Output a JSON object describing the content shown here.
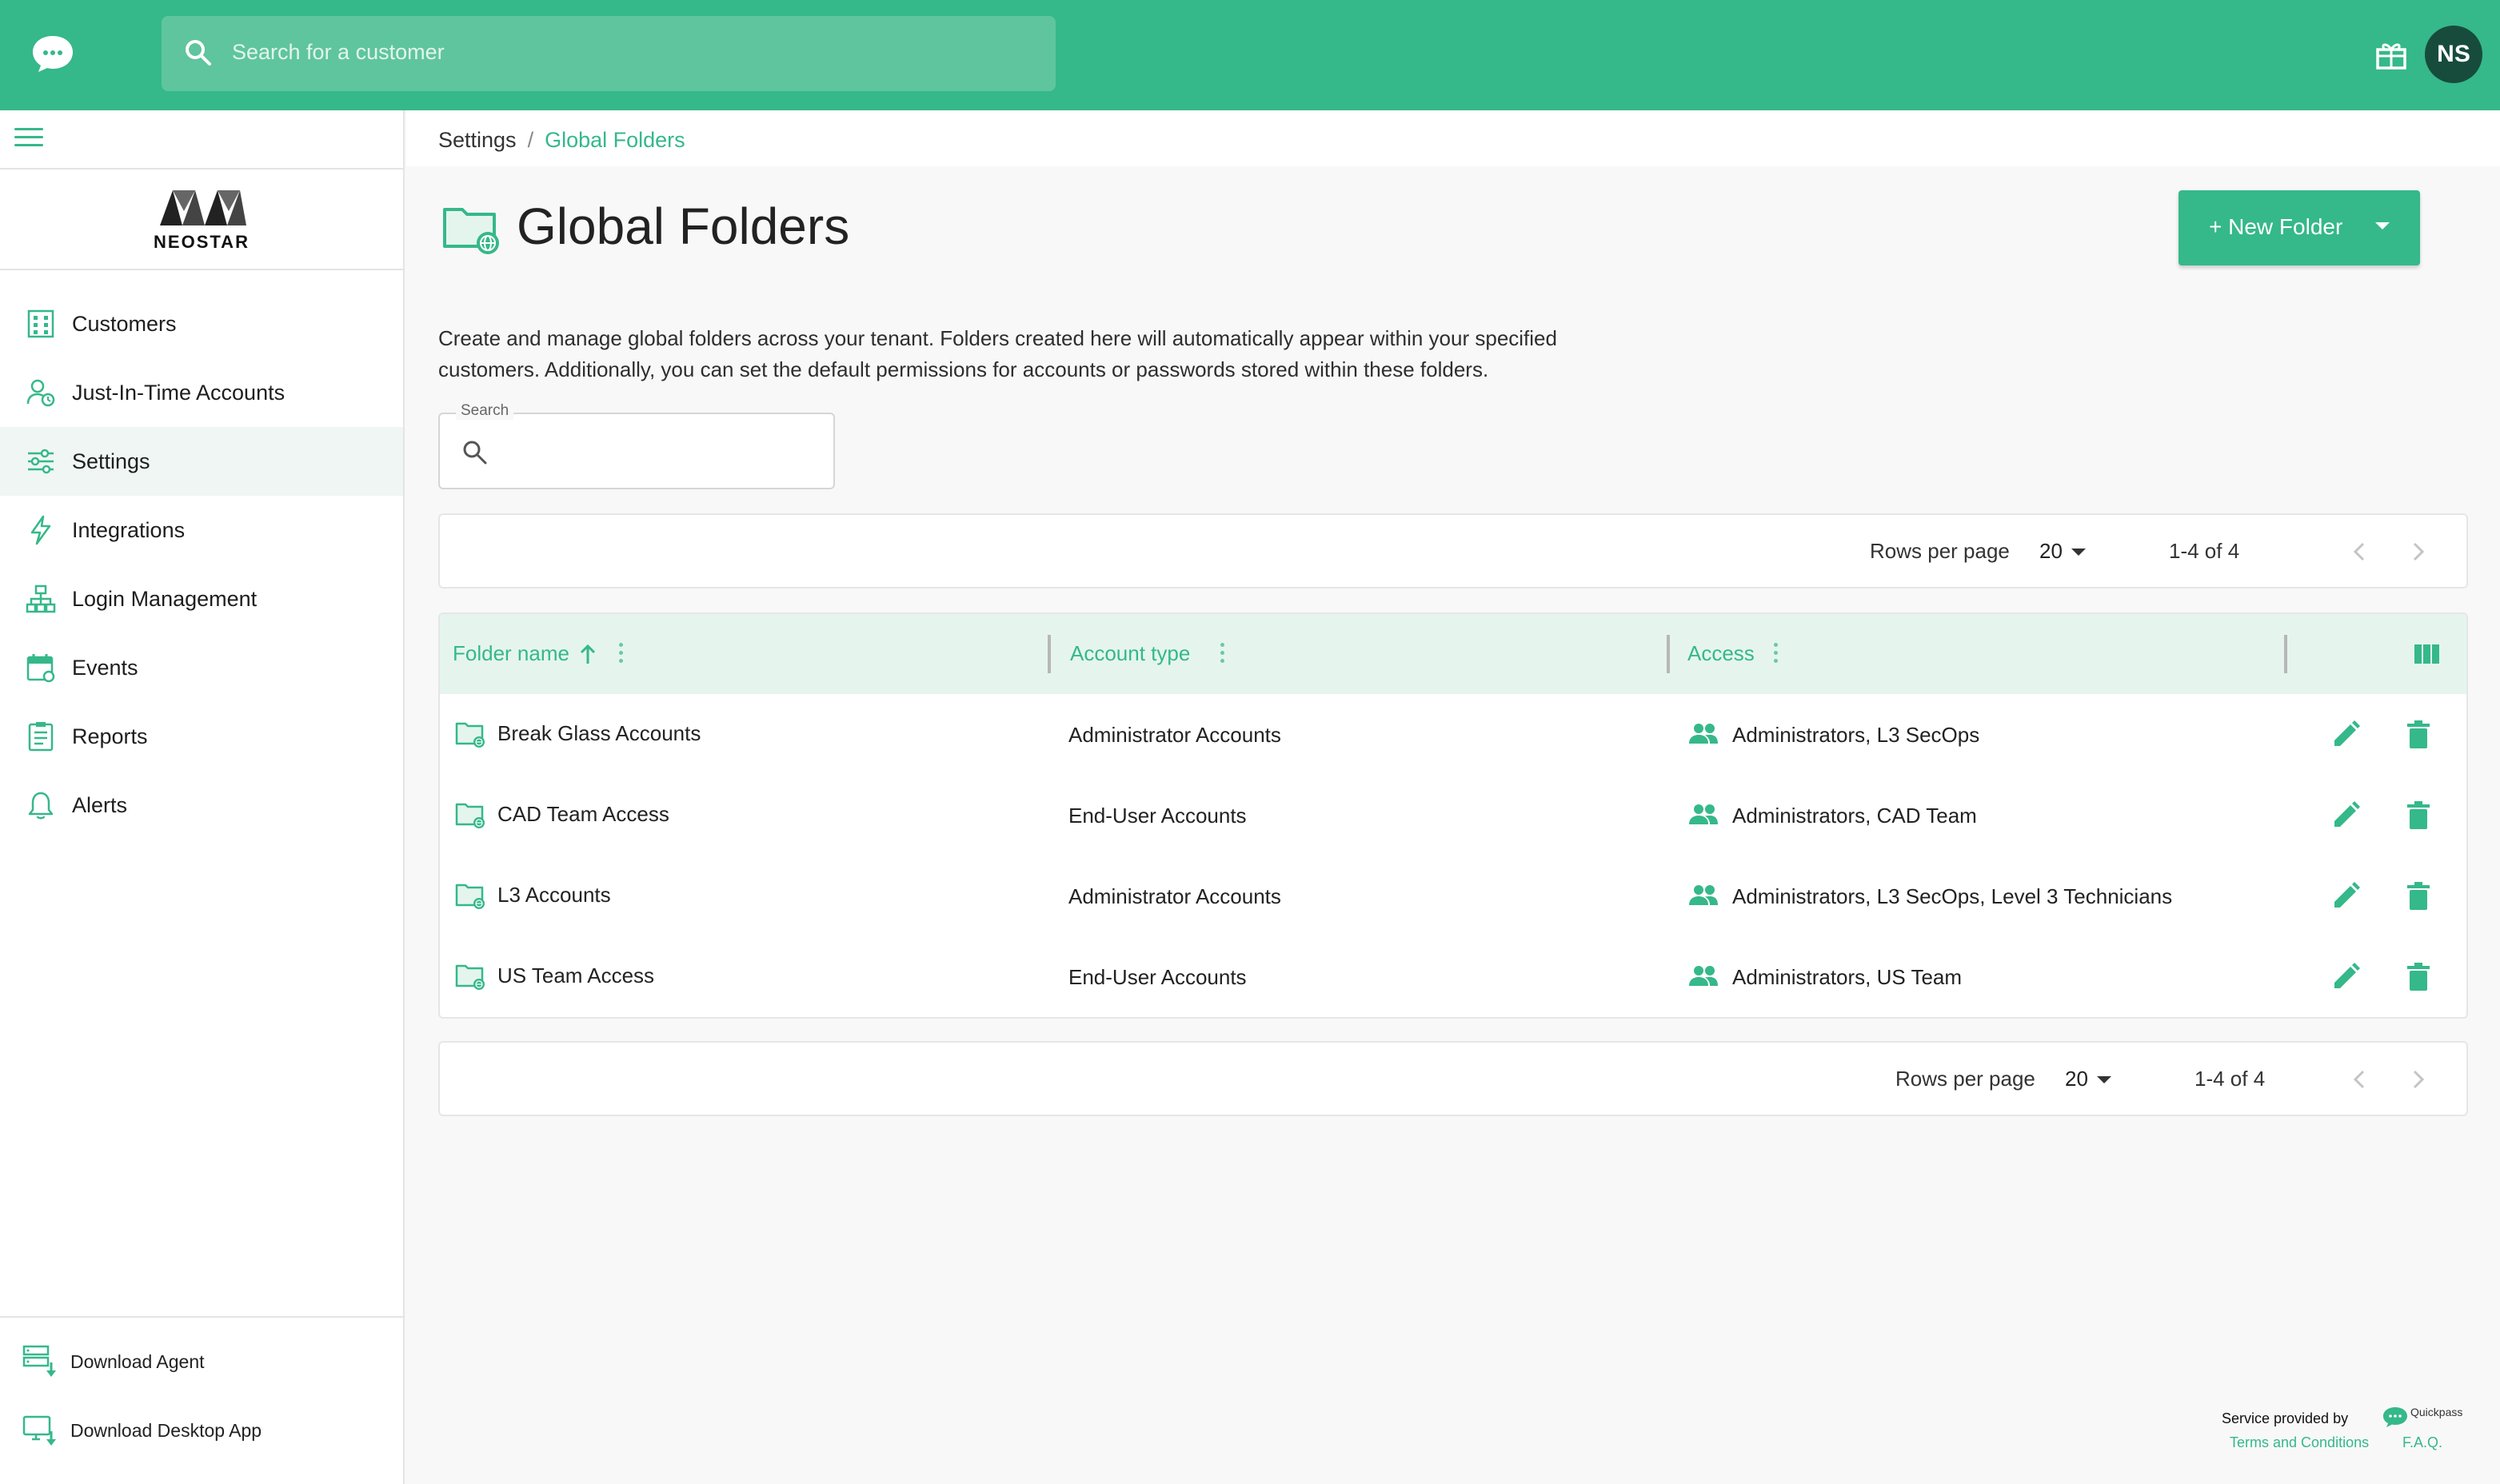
{
  "topbar": {
    "search_placeholder": "Search for a customer",
    "avatar_initials": "NS",
    "brand_color": "#35b88a"
  },
  "sidebar": {
    "brand_name": "NEOSTAR",
    "items": [
      {
        "label": "Customers",
        "icon": "building-icon"
      },
      {
        "label": "Just-In-Time Accounts",
        "icon": "user-clock-icon"
      },
      {
        "label": "Settings",
        "icon": "sliders-icon",
        "active": true
      },
      {
        "label": "Integrations",
        "icon": "bolt-icon"
      },
      {
        "label": "Login Management",
        "icon": "sitemap-icon"
      },
      {
        "label": "Events",
        "icon": "calendar-icon"
      },
      {
        "label": "Reports",
        "icon": "clipboard-icon"
      },
      {
        "label": "Alerts",
        "icon": "bell-icon"
      }
    ],
    "downloads": [
      {
        "label": "Download Agent",
        "icon": "server-download-icon"
      },
      {
        "label": "Download Desktop App",
        "icon": "monitor-download-icon"
      }
    ]
  },
  "breadcrumb": {
    "parent": "Settings",
    "separator": "/",
    "current": "Global Folders"
  },
  "page": {
    "title": "Global Folders",
    "new_folder_label": "+ New Folder",
    "description": "Create and manage global folders across your tenant. Folders created here will automatically appear within your specified customers. Additionally, you can set the default permissions for accounts or passwords stored within these folders.",
    "search_label": "Search"
  },
  "pagination": {
    "rows_per_page_label": "Rows per page",
    "rows_per_page": "20",
    "range": "1-4 of 4"
  },
  "table": {
    "columns": [
      "Folder name",
      "Account type",
      "Access"
    ],
    "sort_column": "Folder name",
    "sort_direction": "ascending",
    "rows": [
      {
        "name": "Break Glass Accounts",
        "type": "Administrator Accounts",
        "access": "Administrators, L3 SecOps"
      },
      {
        "name": "CAD Team Access",
        "type": "End-User Accounts",
        "access": "Administrators, CAD Team"
      },
      {
        "name": "L3 Accounts",
        "type": "Administrator Accounts",
        "access": "Administrators, L3 SecOps, Level 3 Technicians"
      },
      {
        "name": "US Team Access",
        "type": "End-User Accounts",
        "access": "Administrators, US Team"
      }
    ]
  },
  "footer": {
    "service_text": "Service provided by",
    "provider_logo_text": "Quickpass",
    "terms_label": "Terms and Conditions",
    "faq_label": "F.A.Q."
  }
}
